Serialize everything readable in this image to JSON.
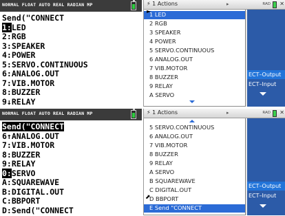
{
  "calc_top": {
    "status": "NORMAL FLOAT AUTO REAL RADIAN MP",
    "lines": [
      "Send(\"CONNECT",
      "1:LED",
      "2:RGB",
      "3:SPEAKER",
      "4:POWER",
      "5:SERVO.CONTINUOUS",
      "6:ANALOG.OUT",
      "7:VIB.MOTOR",
      "8:BUZZER",
      "9↓RELAY"
    ]
  },
  "calc_bot": {
    "status": "NORMAL FLOAT AUTO REAL RADIAN MP",
    "lines": [
      "Send(\"CONNECT",
      "6↑ANALOG.OUT",
      "7:VIB.MOTOR",
      "8:BUZZER",
      "9:RELAY",
      "0:SERVO",
      "A:SQUAREWAVE",
      "B:DIGITAL.OUT",
      "C:BBPORT",
      "D:Send(\"CONNECT"
    ]
  },
  "ns_top": {
    "tab": "1  Actions",
    "rad": "RAD",
    "menu_items": [
      "1  LED",
      "2  RGB",
      "3  SPEAKER",
      "4  POWER",
      "5  SERVO.CONTINUOUS",
      "6  ANALOG.OUT",
      "7  VIB.MOTOR",
      "8  BUZZER",
      "9  RELAY",
      "A  SERVO"
    ],
    "side_items": [
      "ECT–Output",
      "ECT–Input"
    ],
    "behind_char": ")"
  },
  "ns_bot": {
    "tab": "1  Actions",
    "rad": "RAD",
    "menu_items": [
      "5  SERVO.CONTINUOUS",
      "6  ANALOG.OUT",
      "7  VIB.MOTOR",
      "8  BUZZER",
      "9  RELAY",
      "A  SERVO",
      "B  SQUAREWAVE",
      "C  DIGITAL.OUT",
      "D  BBPORT",
      "E  Send \"CONNECT"
    ],
    "side_items": [
      "ECT–Output",
      "ECT–Input"
    ],
    "behind_char": ")"
  },
  "colors": {
    "menu_select": "#2b6bd6",
    "side_pane": "#2c5ba8",
    "calc_status": "#3b3b3b"
  }
}
